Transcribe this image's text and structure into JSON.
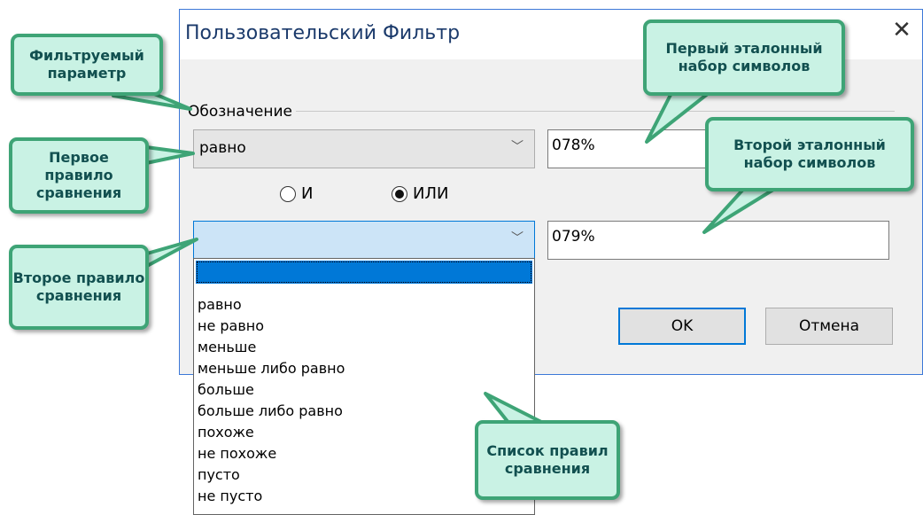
{
  "dialog": {
    "title": "Пользовательский Фильтр",
    "close_glyph": "✕",
    "group_label": "Обозначение",
    "first_rule": {
      "value": "равно",
      "arrow": "﹀"
    },
    "first_text": "078%",
    "radio_and": "И",
    "radio_or": "ИЛИ",
    "radio_selected": "ИЛИ",
    "second_rule": {
      "value": "",
      "arrow": "﹀"
    },
    "second_text": "079%",
    "ok_label": "OK",
    "cancel_label": "Отмена"
  },
  "dropdown": {
    "items": [
      "",
      "равно",
      "не равно",
      "меньше",
      "меньше либо равно",
      "больше",
      "больше либо равно",
      "похоже",
      "не похоже",
      "пусто",
      "не пусто"
    ]
  },
  "callouts": {
    "filter_param": "Фильтруемый параметр",
    "first_rule": "Первое правило сравнения",
    "second_rule": "Второе правило сравнения",
    "first_set": "Первый эталонный набор символов",
    "second_set": "Второй эталонный набор символов",
    "rules_list": "Список правил сравнения"
  },
  "colors": {
    "callout_fill": "#c9f2e4",
    "callout_border": "#3ea476",
    "callout_text": "#125050",
    "selection": "#0078d7"
  }
}
